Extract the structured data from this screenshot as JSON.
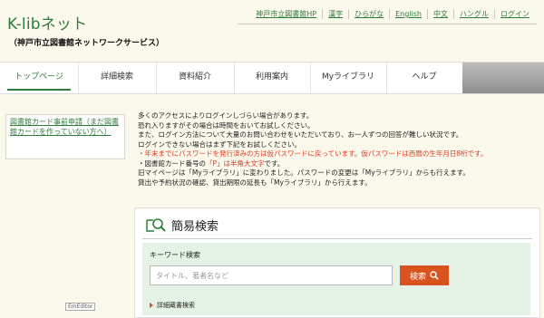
{
  "header": {
    "logo": "K-libネット",
    "subtitle": "（神戸市立図書館ネットワークサービス）",
    "links": [
      "神戸市立図書館HP",
      "漢字",
      "ひらがな",
      "English",
      "中文",
      "ハングル",
      "ログイン"
    ]
  },
  "nav": {
    "items": [
      "トップページ",
      "詳細検索",
      "資料紹介",
      "利用案内",
      "Myライブラリ",
      "ヘルプ"
    ]
  },
  "sidebar": {
    "link": "図書館カード事前申請（まだ図書館カードを作っていない方へ）",
    "tag": "EmEditor"
  },
  "notice": {
    "lines": [
      "多くのアクセスによりログインしづらい場合があります。",
      "恐れ入りますがその場合は時間をおいてお試しください。",
      "また、ログイン方法について大量のお問い合わせをいただいており、お一人ずつの回答が難しい状況です。",
      "ログインできない場合はまず下記をお試しください。"
    ],
    "red_line": "・年末までにパスワードを発行済みの方は仮パスワードに戻っています。仮パスワードは西暦の生年月日8桁です。",
    "card_prefix": "・図書館カード番号の",
    "card_red": "「P」は半角大文字",
    "card_suffix": "です。",
    "extra_lines": [
      "旧マイページは「Myライブラリ」に変わりました。パスワードの変更は「Myライブラリ」からも行えます。",
      "貸出や予約状況の確認、貸出期限の延長も「Myライブラリ」から行えます。"
    ]
  },
  "search": {
    "title": "簡易検索",
    "keyword_label": "キーワード検索",
    "placeholder": "タイトル、著者名など",
    "button": "検索",
    "advanced": "詳細蔵書検索"
  },
  "colors": {
    "brand_green": "#2f7d3c",
    "accent_orange": "#d9531e",
    "notice_red": "#e03a1e",
    "panel_green": "#e4f3e6",
    "background": "#fbf8ec"
  }
}
